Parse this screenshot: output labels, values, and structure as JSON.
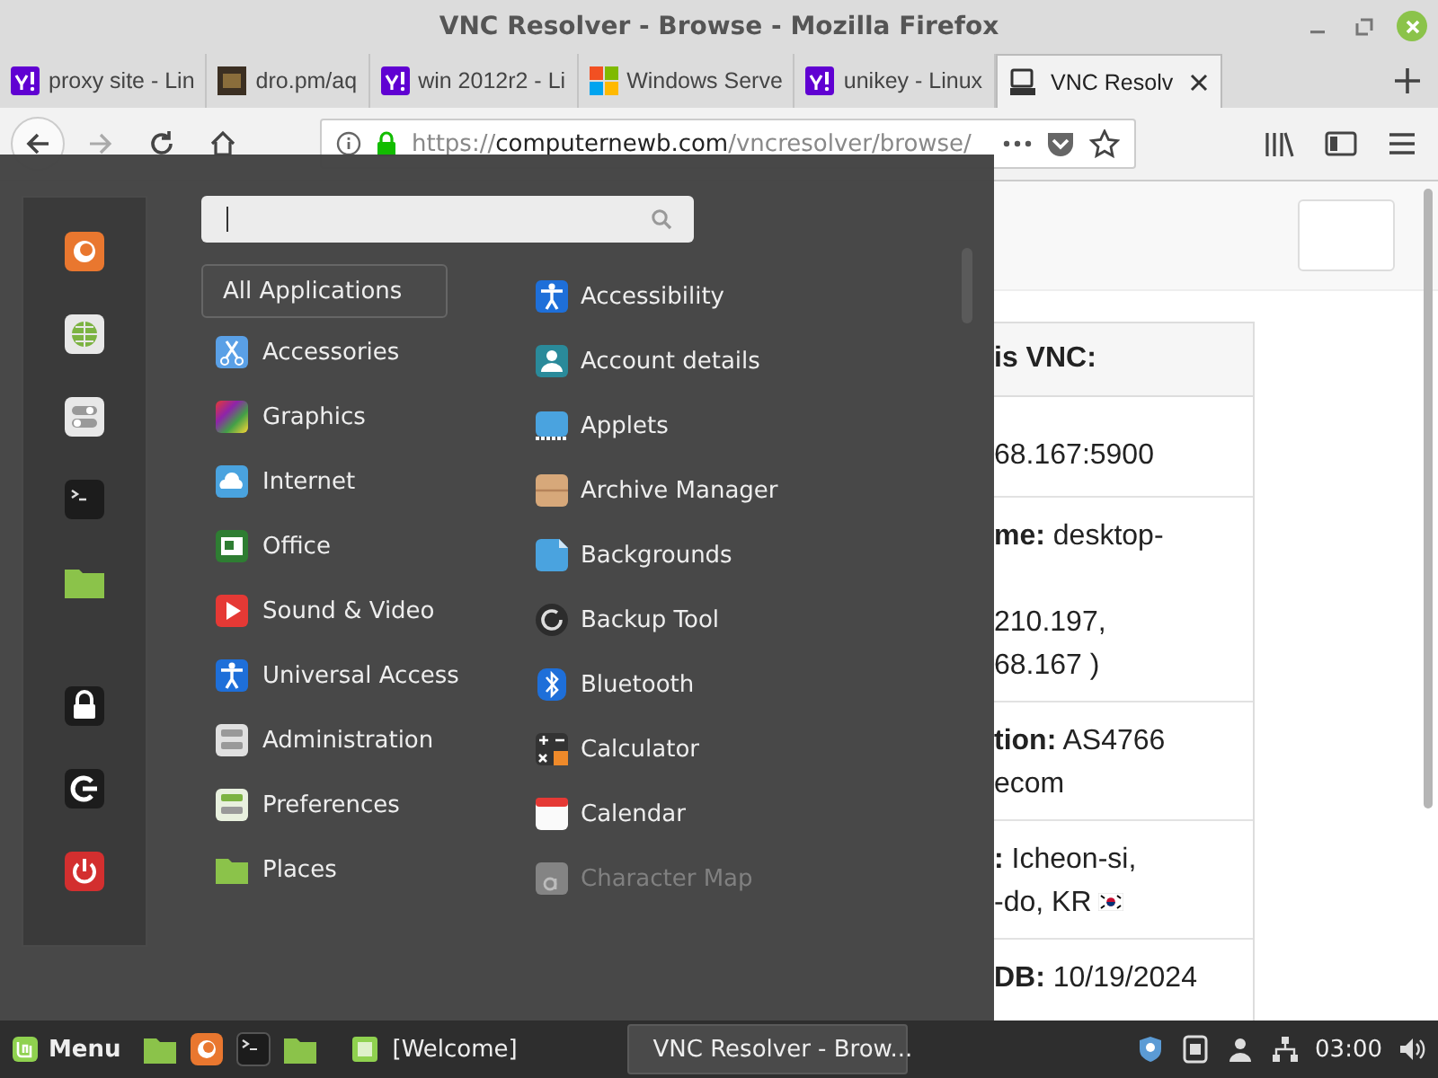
{
  "window": {
    "title": "VNC Resolver - Browse - Mozilla Firefox"
  },
  "tabs": [
    {
      "label": "proxy site - Lin",
      "selected": false,
      "kind": "letter"
    },
    {
      "label": "dro.pm/aq",
      "selected": false,
      "kind": "photo"
    },
    {
      "label": "win 2012r2 - Li",
      "selected": false,
      "kind": "letter"
    },
    {
      "label": "Windows Serve",
      "selected": false,
      "kind": "tiles"
    },
    {
      "label": "unikey - Linux",
      "selected": false,
      "kind": "letter"
    },
    {
      "label": "VNC Resolv",
      "selected": true,
      "kind": "computer"
    }
  ],
  "address": {
    "scheme": "https://",
    "host": "computernewb.com",
    "path": "/vncresolver/browse/"
  },
  "menu": {
    "categories": [
      {
        "label": "All Applications",
        "selected": true
      },
      {
        "label": "Accessories",
        "selected": false
      },
      {
        "label": "Graphics",
        "selected": false
      },
      {
        "label": "Internet",
        "selected": false
      },
      {
        "label": "Office",
        "selected": false
      },
      {
        "label": "Sound & Video",
        "selected": false
      },
      {
        "label": "Universal Access",
        "selected": false
      },
      {
        "label": "Administration",
        "selected": false
      },
      {
        "label": "Preferences",
        "selected": false
      },
      {
        "label": "Places",
        "selected": false
      }
    ],
    "apps": [
      {
        "label": "Accessibility",
        "dimmed": false
      },
      {
        "label": "Account details",
        "dimmed": false
      },
      {
        "label": "Applets",
        "dimmed": false
      },
      {
        "label": "Archive Manager",
        "dimmed": false
      },
      {
        "label": "Backgrounds",
        "dimmed": false
      },
      {
        "label": "Backup Tool",
        "dimmed": false
      },
      {
        "label": "Bluetooth",
        "dimmed": false
      },
      {
        "label": "Calculator",
        "dimmed": false
      },
      {
        "label": "Calendar",
        "dimmed": false
      },
      {
        "label": "Character Map",
        "dimmed": true
      }
    ]
  },
  "page": {
    "card": {
      "heading": "is VNC:",
      "rows": [
        {
          "lines": [
            "68.167:5900"
          ],
          "flag": false
        },
        {
          "lines": [
            "**me:** desktop-",
            "210.197,",
            "68.167 )"
          ],
          "flag": false
        },
        {
          "lines": [
            "**tion:** AS4766",
            "ecom"
          ],
          "flag": false
        },
        {
          "lines": [
            "**:** Icheon-si,",
            "-do, KR"
          ],
          "flag": true
        },
        {
          "lines": [
            "**DB:** 10/19/2024"
          ],
          "flag": false
        }
      ]
    }
  },
  "taskbar": {
    "menu_label": "Menu",
    "windows": [
      {
        "label": "[Welcome]",
        "selected": false
      },
      {
        "label": "VNC Resolver - Brow...",
        "selected": true
      }
    ],
    "clock": "03:00"
  }
}
